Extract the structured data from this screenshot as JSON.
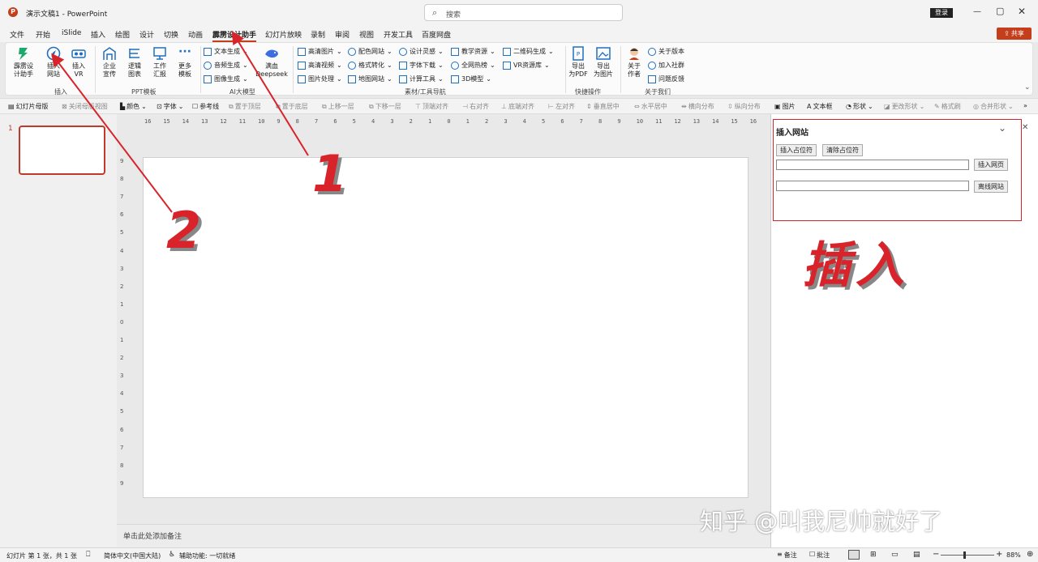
{
  "colors": {
    "accent": "#c43e1c",
    "annot_red": "#d9232b",
    "share": "#c43e1c",
    "slide_border": "#c0392b"
  },
  "titlebar": {
    "doc_title": "演示文稿1 - PowerPoint",
    "search_placeholder": "搜索",
    "login": "登录",
    "share": "共享"
  },
  "menu": [
    "文件",
    "开始",
    "iSlide",
    "插入",
    "绘图",
    "设计",
    "切换",
    "动画",
    "霹雳设计助手",
    "幻灯片放映",
    "录制",
    "审阅",
    "视图",
    "开发工具",
    "百度网盘"
  ],
  "menu_active": "霹雳设计助手",
  "ribbon": {
    "big_buttons": {
      "pili_helper": "霹雳设\n计助手",
      "insert_web": "插入\n网站",
      "insert_vr": "插入\nVR",
      "enterprise": "企业\n宣传",
      "logic": "逻辑\n图表",
      "work_report": "工作\n汇报",
      "more": "更多\n模板",
      "deepseek": "满血\nDeepseek",
      "export_pdf": "导出\n为PDF",
      "export_img": "导出\n为图片",
      "about_author": "关于\n作者"
    },
    "ai_items": [
      "文本生成",
      "音频生成",
      "图像生成"
    ],
    "material_col1": [
      "高清图片",
      "高清视频",
      "图片处理"
    ],
    "material_col2": [
      "配色网站",
      "格式转化",
      "地图网站"
    ],
    "material_col3": [
      "设计灵感",
      "字体下载",
      "计算工具"
    ],
    "material_col4": [
      "教学资源",
      "全网热榜",
      "3D模型"
    ],
    "material_col5": [
      "二维码生成",
      "VR资源库"
    ],
    "about_items": [
      "关于版本",
      "加入社群",
      "问题反馈"
    ],
    "groups": {
      "insert": "插入",
      "ppt_template": "PPT模板",
      "ai": "AI大模型",
      "material": "素材/工具导航",
      "quick": "快捷操作",
      "about": "关于我们"
    }
  },
  "qa_toolbar": [
    "幻灯片母版",
    "关闭母版视图",
    "颜色",
    "字体",
    "参考线",
    "置于顶层",
    "置于底层",
    "上移一层",
    "下移一层",
    "顶端对齐",
    "右对齐",
    "底端对齐",
    "左对齐",
    "垂直居中",
    "水平居中",
    "横向分布",
    "纵向分布",
    "图片",
    "文本框",
    "形状",
    "更改形状",
    "格式刷",
    "合并形状"
  ],
  "thumb": {
    "number": "1"
  },
  "ruler_h": [
    "16",
    "15",
    "14",
    "13",
    "12",
    "11",
    "10",
    "9",
    "8",
    "7",
    "6",
    "5",
    "4",
    "3",
    "2",
    "1",
    "0",
    "1",
    "2",
    "3",
    "4",
    "5",
    "6",
    "7",
    "8",
    "9",
    "10",
    "11",
    "12",
    "13",
    "14",
    "15",
    "16"
  ],
  "ruler_v": [
    "9",
    "8",
    "7",
    "6",
    "5",
    "4",
    "3",
    "2",
    "1",
    "0",
    "1",
    "2",
    "3",
    "4",
    "5",
    "6",
    "7",
    "8",
    "9"
  ],
  "notes_placeholder": "单击此处添加备注",
  "taskpane": {
    "title": "插入网站",
    "btn_insert_placeholder": "插入占位符",
    "btn_clear_placeholder": "清除占位符",
    "btn_insert_page": "插入网页",
    "btn_offline": "离线网站"
  },
  "annotations": {
    "num1": "1",
    "num2": "2",
    "big_label": "插入",
    "watermark": "知乎 @叫我尼帅就好了"
  },
  "status": {
    "slide_info": "幻灯片 第 1 张，共 1 张",
    "language": "简体中文(中国大陆)",
    "accessibility": "辅助功能: 一切就绪",
    "notes": "备注",
    "comments": "批注",
    "zoom": "88%"
  }
}
